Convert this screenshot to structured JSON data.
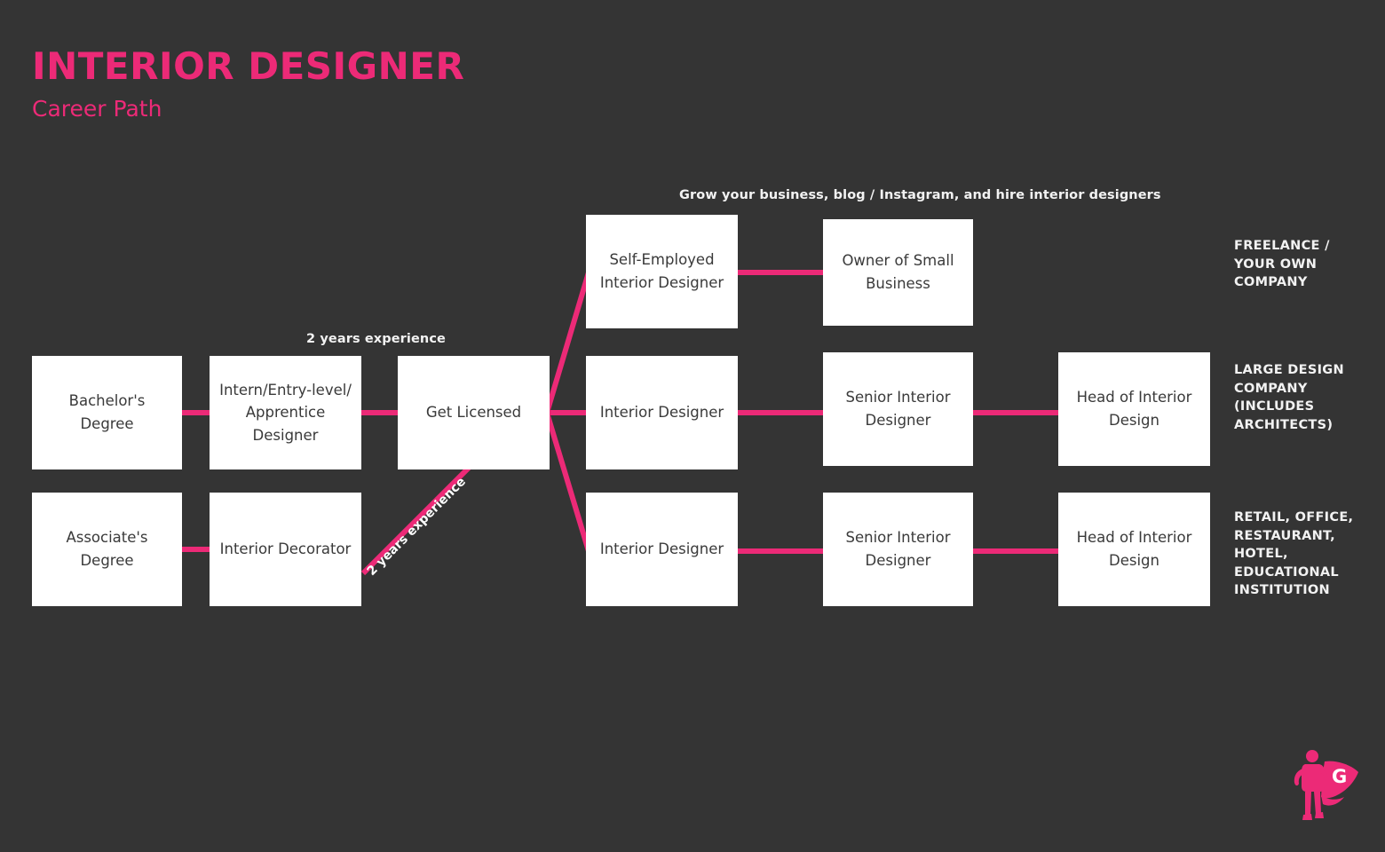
{
  "header": {
    "title": "INTERIOR DESIGNER",
    "subtitle": "Career Path"
  },
  "colors": {
    "background": "#343434",
    "accent": "#EC2A77",
    "node_fill": "#FFFFFF",
    "node_text": "#3A3A3A",
    "label_text": "#F2F2F2"
  },
  "annotations": {
    "grow_business": "Grow your business, blog / Instagram, and hire interior designers",
    "two_years_top": "2 years experience",
    "two_years_diagonal": "2 years experience"
  },
  "lanes": [
    {
      "id": "freelance",
      "label": "FREELANCE /\nYOUR OWN\nCOMPANY"
    },
    {
      "id": "large-design",
      "label": "LARGE DESIGN\nCOMPANY\n(INCLUDES\nARCHITECTS)"
    },
    {
      "id": "retail-office",
      "label": "RETAIL, OFFICE,\nRESTAURANT,\nHOTEL,\nEDUCATIONAL\nINSTITUTION"
    }
  ],
  "nodes": [
    {
      "id": "bachelors-degree",
      "label": "Bachelor's Degree"
    },
    {
      "id": "intern-entry-apprentice",
      "label": "Intern/Entry-level/\nApprentice\nDesigner"
    },
    {
      "id": "get-licensed",
      "label": "Get Licensed"
    },
    {
      "id": "associates-degree",
      "label": "Associate's Degree"
    },
    {
      "id": "interior-decorator",
      "label": "Interior Decorator"
    },
    {
      "id": "self-employed-interior-designer",
      "label": "Self-Employed\nInterior Designer"
    },
    {
      "id": "owner-small-business",
      "label": "Owner of Small\nBusiness"
    },
    {
      "id": "interior-designer-large",
      "label": "Interior Designer"
    },
    {
      "id": "senior-interior-designer-large",
      "label": "Senior Interior\nDesigner"
    },
    {
      "id": "head-interior-design-large",
      "label": "Head of Interior\nDesign"
    },
    {
      "id": "interior-designer-retail",
      "label": "Interior Designer"
    },
    {
      "id": "senior-interior-designer-retail",
      "label": "Senior Interior\nDesigner"
    },
    {
      "id": "head-interior-design-retail",
      "label": "Head of Interior\nDesign"
    }
  ],
  "logo": {
    "letter": "G",
    "name": "superhero-logo"
  }
}
